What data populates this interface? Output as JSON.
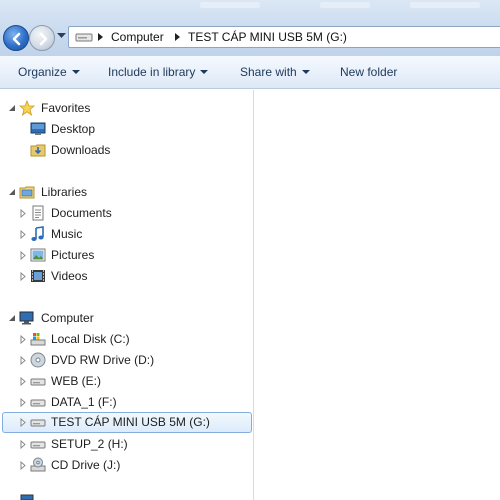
{
  "address": {
    "crumbs": [
      "Computer",
      "TEST CÁP MINI USB 5M (G:)"
    ]
  },
  "toolbar": {
    "organize": "Organize",
    "include": "Include in library",
    "share": "Share with",
    "new_folder": "New folder"
  },
  "nav": {
    "favorites": {
      "label": "Favorites",
      "items": [
        "Desktop",
        "Downloads"
      ]
    },
    "libraries": {
      "label": "Libraries",
      "items": [
        "Documents",
        "Music",
        "Pictures",
        "Videos"
      ]
    },
    "computer": {
      "label": "Computer",
      "items": [
        "Local Disk (C:)",
        "DVD RW Drive (D:)",
        "WEB (E:)",
        "DATA_1 (F:)",
        "TEST CÁP MINI USB 5M (G:)",
        "SETUP_2 (H:)",
        "CD Drive (J:)"
      ],
      "selected": "TEST CÁP MINI USB 5M (G:)"
    }
  },
  "colors": {
    "selection_border": "#84acdd",
    "toolbar_text": "#1e395b"
  }
}
